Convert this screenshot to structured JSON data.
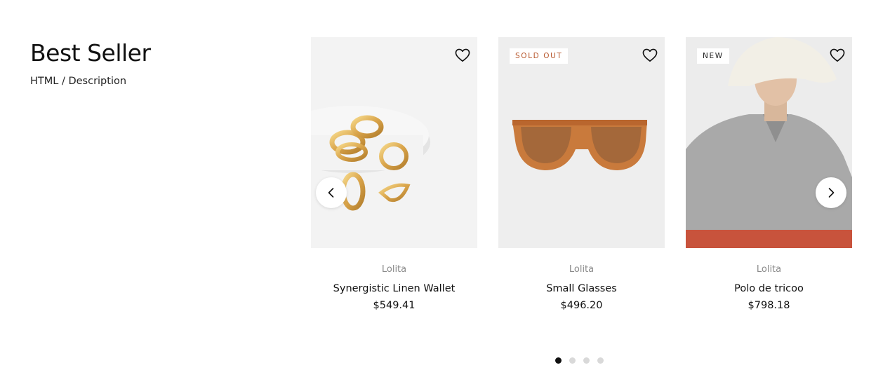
{
  "section": {
    "title": "Best Seller",
    "description": "HTML / Description"
  },
  "products": [
    {
      "brand": "Lolita",
      "name": "Synergistic Linen Wallet",
      "price": "$549.41",
      "badge": "",
      "image_icon": "gold-rings-image"
    },
    {
      "brand": "Lolita",
      "name": "Small Glasses",
      "price": "$496.20",
      "badge": "SOLD OUT",
      "image_icon": "sunglasses-image"
    },
    {
      "brand": "Lolita",
      "name": "Polo de tricoo",
      "price": "$798.18",
      "badge": "NEW",
      "image_icon": "polo-model-image"
    }
  ],
  "icons": {
    "wishlist": "heart-icon",
    "prev": "chevron-left-icon",
    "next": "chevron-right-icon"
  },
  "pagination": {
    "pages": 4,
    "active": 1
  },
  "colors": {
    "sold_out": "#b8572c",
    "active_dot": "#111111",
    "inactive_dot": "#d9d9d9"
  }
}
